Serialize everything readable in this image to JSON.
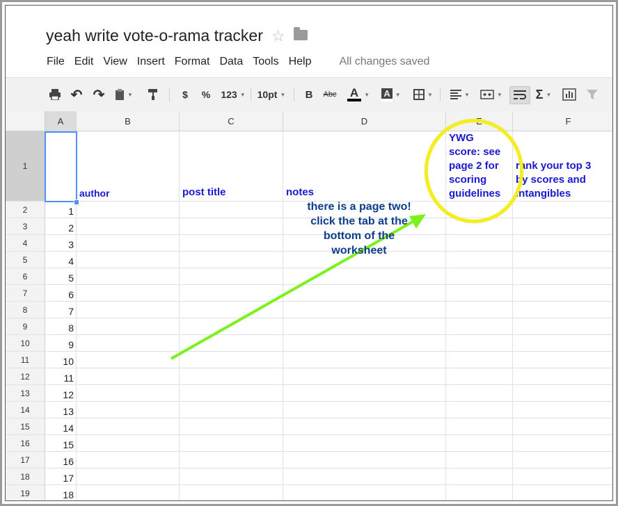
{
  "doc": {
    "title": "yeah write vote-o-rama tracker"
  },
  "menu": {
    "items": [
      "File",
      "Edit",
      "View",
      "Insert",
      "Format",
      "Data",
      "Tools",
      "Help"
    ],
    "status": "All changes saved"
  },
  "toolbar": {
    "currency": "$",
    "percent": "%",
    "number_format": "123",
    "font_size": "10pt",
    "bold": "B",
    "strikethrough": "Abc",
    "text_color": "A",
    "fill_color": "A",
    "sum": "Σ"
  },
  "columns": [
    "A",
    "B",
    "C",
    "D",
    "E",
    "F"
  ],
  "row_numbers": [
    "1",
    "2",
    "3",
    "4",
    "5",
    "6",
    "7",
    "8",
    "9",
    "10",
    "11",
    "12",
    "13",
    "14",
    "15",
    "16",
    "17",
    "18",
    "19"
  ],
  "sheet": {
    "header": {
      "author": "author",
      "post_title": "post title",
      "notes": "notes",
      "ywg_score": [
        "YWG",
        "score: see",
        "page 2 for",
        "scoring",
        "guidelines"
      ],
      "rank": [
        "rank your top 3",
        "by scores and",
        "intangibles"
      ]
    },
    "a_values": [
      "1",
      "2",
      "3",
      "4",
      "5",
      "6",
      "7",
      "8",
      "9",
      "10",
      "11",
      "12",
      "13",
      "14",
      "15",
      "16",
      "17",
      "18"
    ]
  },
  "annotation": {
    "lines": [
      "there is a page two!",
      "click the tab at the",
      "bottom of the",
      "worksheet"
    ]
  },
  "colors": {
    "header_text": "#1919d2",
    "annotation_text": "#0e3d8c",
    "arrow": "#7bf21c",
    "circle": "#f4ee20",
    "selection": "#4d90fe"
  }
}
